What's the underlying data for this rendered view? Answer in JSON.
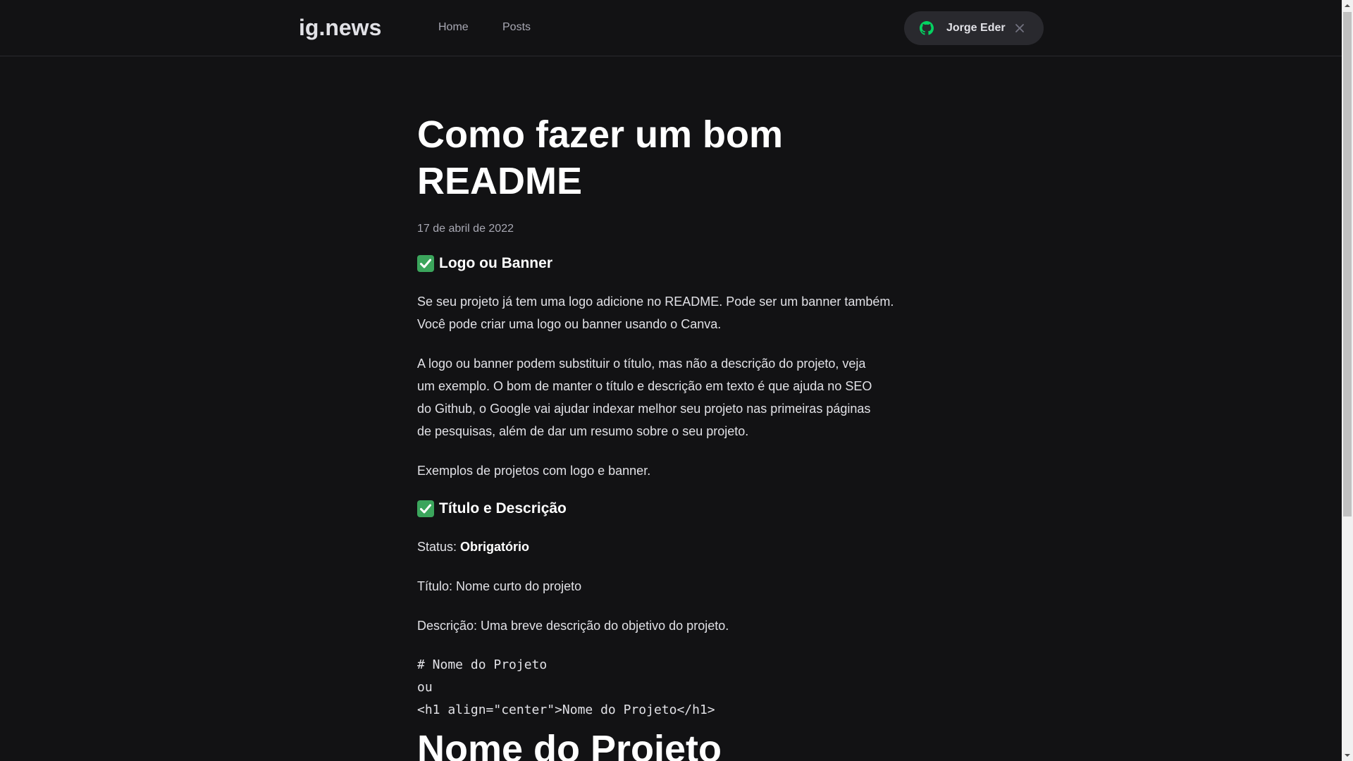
{
  "header": {
    "logo": "ig.news",
    "nav": {
      "home": "Home",
      "posts": "Posts"
    },
    "user": {
      "name": "Jorge Eder"
    },
    "colors": {
      "github_icon": "#04d361",
      "close_icon": "#737380"
    }
  },
  "article": {
    "title": "Como fazer um bom README",
    "date": "17 de abril de 2022",
    "section1": {
      "heading": "Logo ou Banner",
      "icon": "check-mark-button",
      "p1": "Se seu projeto já tem uma logo adicione no README. Pode ser um banner também. Você pode criar uma logo ou banner usando o Canva.",
      "p2": "A logo ou banner podem substituir o título, mas não a descrição do projeto, veja um exemplo. O bom de manter o título e descrição em texto é que ajuda no SEO do Github, o Google vai ajudar indexar melhor seu projeto nas primeiras páginas de pesquisas, além de dar um resumo sobre o seu projeto.",
      "p3": "Exemplos de projetos com logo e banner."
    },
    "section2": {
      "heading": "Título e Descrição",
      "icon": "check-mark-button",
      "status_label": "Status: ",
      "status_value": "Obrigatório",
      "titulo": "Título: Nome curto do projeto",
      "descricao": "Descrição: Uma breve descrição do objetivo do projeto.",
      "code": "# Nome do Projeto\nou\n<h1 align=\"center\">Nome do Projeto</h1>",
      "example_heading": "Nome do Projeto"
    }
  },
  "scrollbar": {
    "position_fraction": 0.0
  }
}
